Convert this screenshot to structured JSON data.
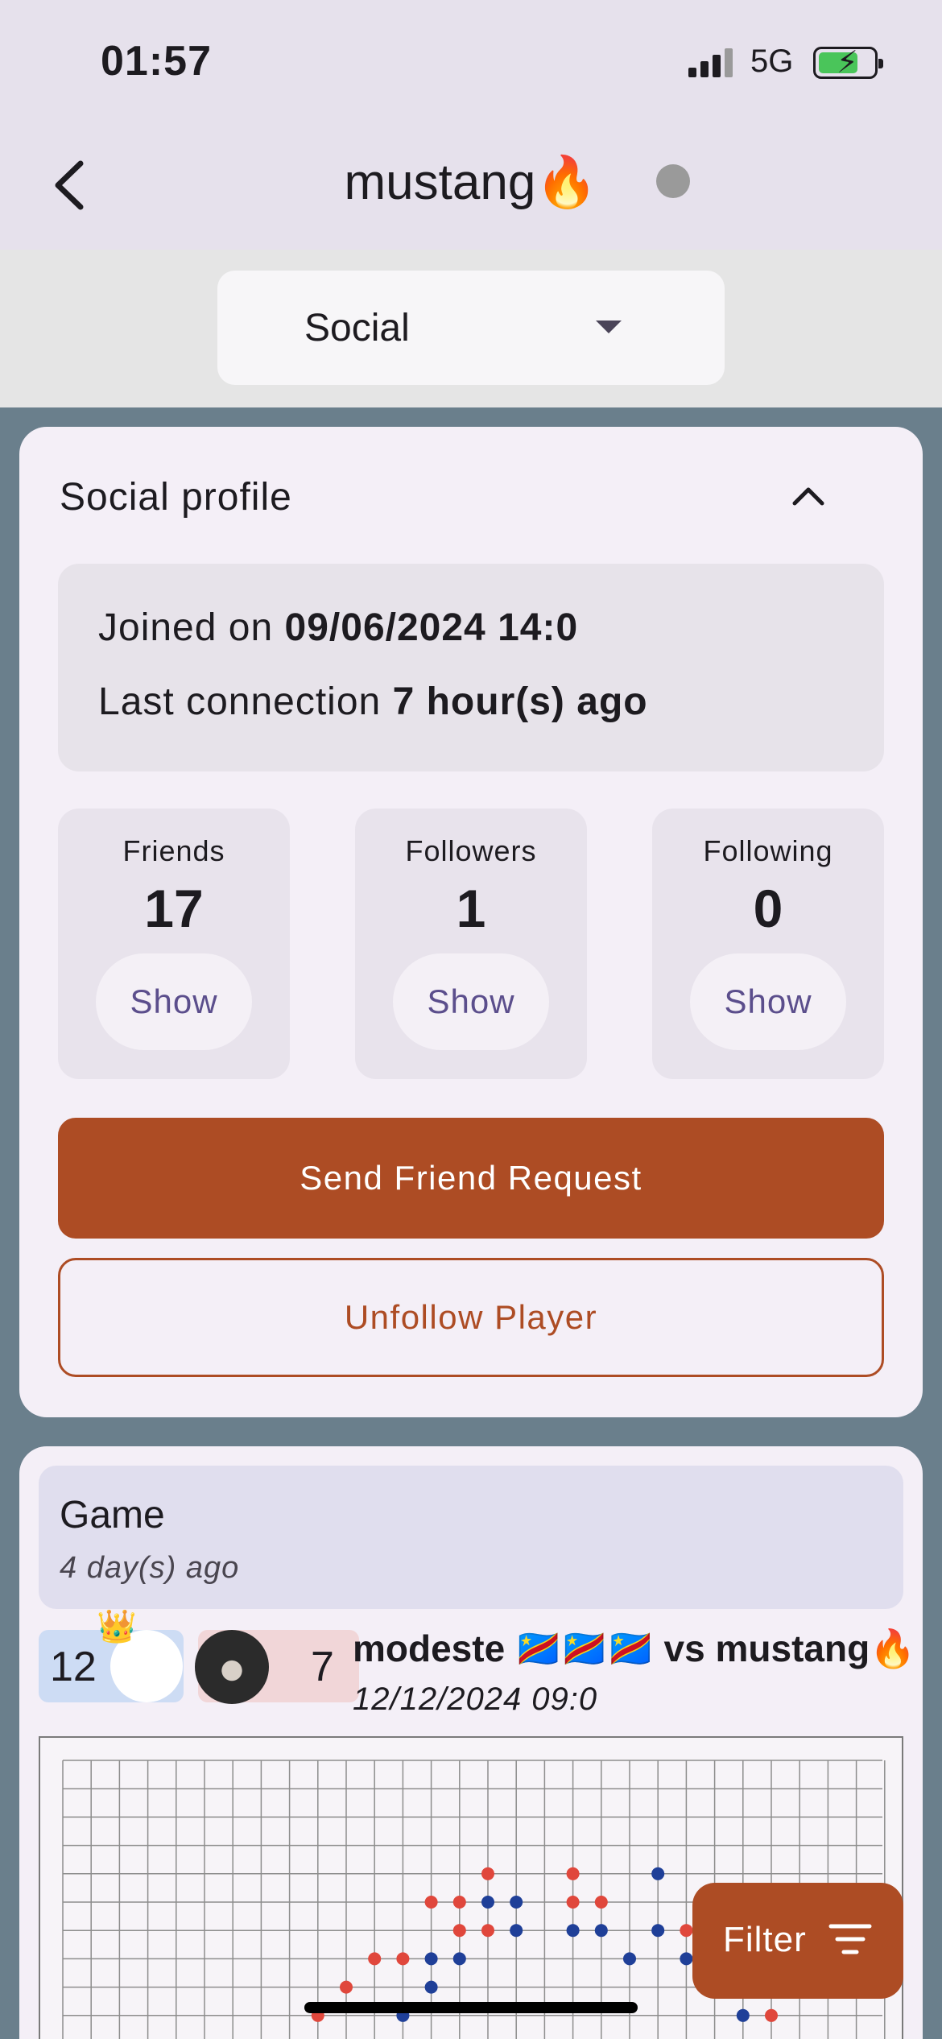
{
  "status": {
    "time": "01:57",
    "network": "5G"
  },
  "appbar": {
    "title": "mustang🔥",
    "online_color": "#9a9a9a"
  },
  "selector": {
    "value": "Social"
  },
  "social": {
    "header": "Social profile",
    "joined_prefix": "Joined on ",
    "joined_value": "09/06/2024 14:0",
    "last_prefix": "Last connection ",
    "last_value": "7 hour(s) ago",
    "stats": [
      {
        "label": "Friends",
        "value": "17",
        "action": "Show"
      },
      {
        "label": "Followers",
        "value": "1",
        "action": "Show"
      },
      {
        "label": "Following",
        "value": "0",
        "action": "Show"
      }
    ],
    "send_request": "Send Friend Request",
    "unfollow": "Unfollow Player"
  },
  "game": {
    "header": "Game",
    "ago": "4 day(s) ago",
    "score_left": "12",
    "score_right": "7",
    "players": "modeste 🇨🇩🇨🇩🇨🇩 vs mustang🔥",
    "date": "12/12/2024 09:0"
  },
  "filter": {
    "label": "Filter"
  },
  "colors": {
    "accent": "#ad4c24",
    "blue_stone": "#1f3f98",
    "red_stone": "#e0473c"
  }
}
